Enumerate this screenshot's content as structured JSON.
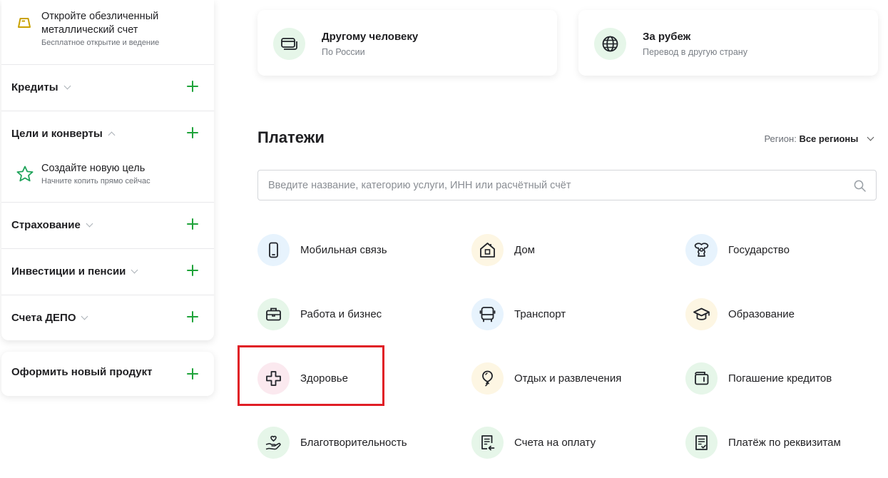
{
  "sidebar": {
    "promo_metal": {
      "title": "Откройте обезличенный металлический счет",
      "subtitle": "Бесплатное открытие и ведение",
      "icon": "gold-bar-icon"
    },
    "sections": [
      {
        "label": "Кредиты",
        "expanded": false
      },
      {
        "label": "Цели и конверты",
        "expanded": true
      },
      {
        "label": "Страхование",
        "expanded": false
      },
      {
        "label": "Инвестиции и пенсии",
        "expanded": false
      },
      {
        "label": "Счета ДЕПО",
        "expanded": false
      }
    ],
    "promo_goal": {
      "title": "Создайте новую цель",
      "subtitle": "Начните копить прямо сейчас",
      "icon": "star-icon"
    },
    "new_product": "Оформить новый продукт"
  },
  "transfers": [
    {
      "title": "Другому человеку",
      "subtitle": "По России",
      "icon": "cards-icon"
    },
    {
      "title": "За рубеж",
      "subtitle": "Перевод в другую страну",
      "icon": "globe-icon"
    }
  ],
  "payments": {
    "title": "Платежи",
    "region_label": "Регион:",
    "region_value": "Все регионы",
    "search_placeholder": "Введите название, категорию услуги, ИНН или расчётный счёт",
    "categories": [
      {
        "label": "Мобильная связь",
        "icon": "phone-icon"
      },
      {
        "label": "Дом",
        "icon": "house-icon"
      },
      {
        "label": "Государство",
        "icon": "emblem-icon"
      },
      {
        "label": "Работа и бизнес",
        "icon": "briefcase-icon"
      },
      {
        "label": "Транспорт",
        "icon": "bus-icon"
      },
      {
        "label": "Образование",
        "icon": "graduation-cap-icon"
      },
      {
        "label": "Здоровье",
        "icon": "medical-cross-icon"
      },
      {
        "label": "Отдых и развлечения",
        "icon": "balloon-icon"
      },
      {
        "label": "Погашение кредитов",
        "icon": "wallet-icon"
      },
      {
        "label": "Благотворительность",
        "icon": "hand-heart-icon"
      },
      {
        "label": "Счета на оплату",
        "icon": "invoice-icon"
      },
      {
        "label": "Платёж по реквизитам",
        "icon": "document-check-icon"
      }
    ]
  },
  "colors": {
    "accent_green": "#1fa33a",
    "highlight_red": "#e01e26"
  }
}
